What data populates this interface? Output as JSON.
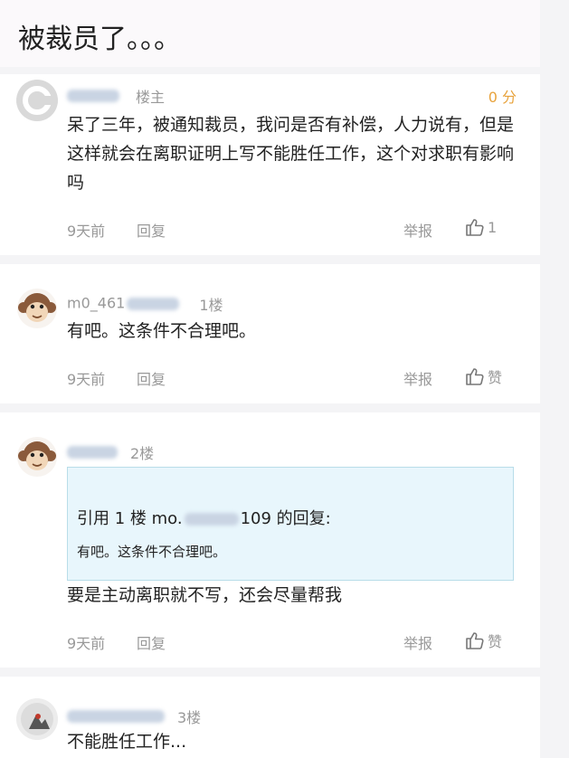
{
  "page": {
    "title": "被裁员了。。。"
  },
  "posts": [
    {
      "badge": "楼主",
      "score": "0 分",
      "content": "呆了三年，被通知裁员，我问是否有补偿，人力说有，但是这样就会在离职证明上写不能胜任工作，这个对求职有影响吗",
      "time": "9天前",
      "reply": "回复",
      "report": "举报",
      "like": "1",
      "avatar": "gear-avatar"
    },
    {
      "username_fragment": "m0_461",
      "badge": "1楼",
      "content": "有吧。这条件不合理吧。",
      "time": "9天前",
      "reply": "回复",
      "report": "举报",
      "like": "赞",
      "avatar": "monkey-avatar"
    },
    {
      "badge": "2楼",
      "quote": {
        "head": "引用 1 楼 mo.",
        "head_suffix": "109 的回复:",
        "body": "有吧。这条件不合理吧。"
      },
      "content": "要是主动离职就不写，还会尽量帮我",
      "time": "9天前",
      "reply": "回复",
      "report": "举报",
      "like": "赞",
      "avatar": "monkey-avatar"
    },
    {
      "badge": "3楼",
      "content": "不能胜任工作...",
      "avatar": "photo-avatar"
    }
  ]
}
